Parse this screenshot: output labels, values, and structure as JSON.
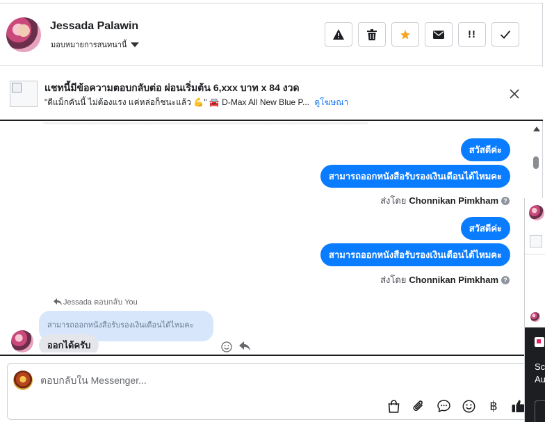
{
  "header": {
    "name": "Jessada Palawin",
    "assign_label": "มอบหมายการสนทนานี้",
    "buttons": [
      {
        "icon": "warning-icon",
        "glyph": "⚠"
      },
      {
        "icon": "trash-icon",
        "glyph": "🗑"
      },
      {
        "icon": "star-icon",
        "glyph": "★"
      },
      {
        "icon": "envelope-icon",
        "glyph": "✉"
      },
      {
        "icon": "follow-up-icon",
        "glyph": "!!"
      },
      {
        "icon": "check-icon",
        "glyph": "✓"
      }
    ],
    "star_color": "#f5a623"
  },
  "ad": {
    "title": "แชทนี้มีข้อความตอบกลับต่อ ผ่อนเริ่มต้น 6,xxx บาท x 84 งวด",
    "subtitle": "\"ดีแม็กคันนี้ ไม่ต้องแรง แค่หล่อก็ชนะแล้ว 💪\" 🚘 D-Max All New Blue P...",
    "link": "ดูโฆษณา"
  },
  "conversation": {
    "outgoing": [
      {
        "text": "สวัสดีค่ะ"
      },
      {
        "text": "สามารถออกหนังสือรับรองเงินเดือนได้ไหมคะ"
      },
      {
        "text": "สวัสดีค่ะ"
      },
      {
        "text": "สามารถออกหนังสือรับรองเงินเดือนได้ไหมคะ"
      }
    ],
    "sent_by_prefix": "ส่งโดย",
    "sent_by_name": "Chonnikan Pimkham",
    "reply_note": "Jessada ตอบกลับ You",
    "quoted_text": "สามารถออกหนังสือรับรองเงินเดือนได้ไหมคะ",
    "incoming_text": "ออกได้ครับ"
  },
  "composer": {
    "placeholder": "ตอบกลับใน Messenger...",
    "icons": [
      "shopping-bag-icon",
      "paperclip-icon",
      "chat-bubble-icon",
      "emoji-icon",
      "baht-icon",
      "thumbs-up-icon"
    ]
  },
  "side_panel": {
    "text_line1": "Sc",
    "text_line2": "Au"
  },
  "colors": {
    "accent": "#0a7cff",
    "link": "#1877f2",
    "incoming_bubble": "#e4e6eb",
    "quoted_bubble": "#d7e6fb"
  }
}
